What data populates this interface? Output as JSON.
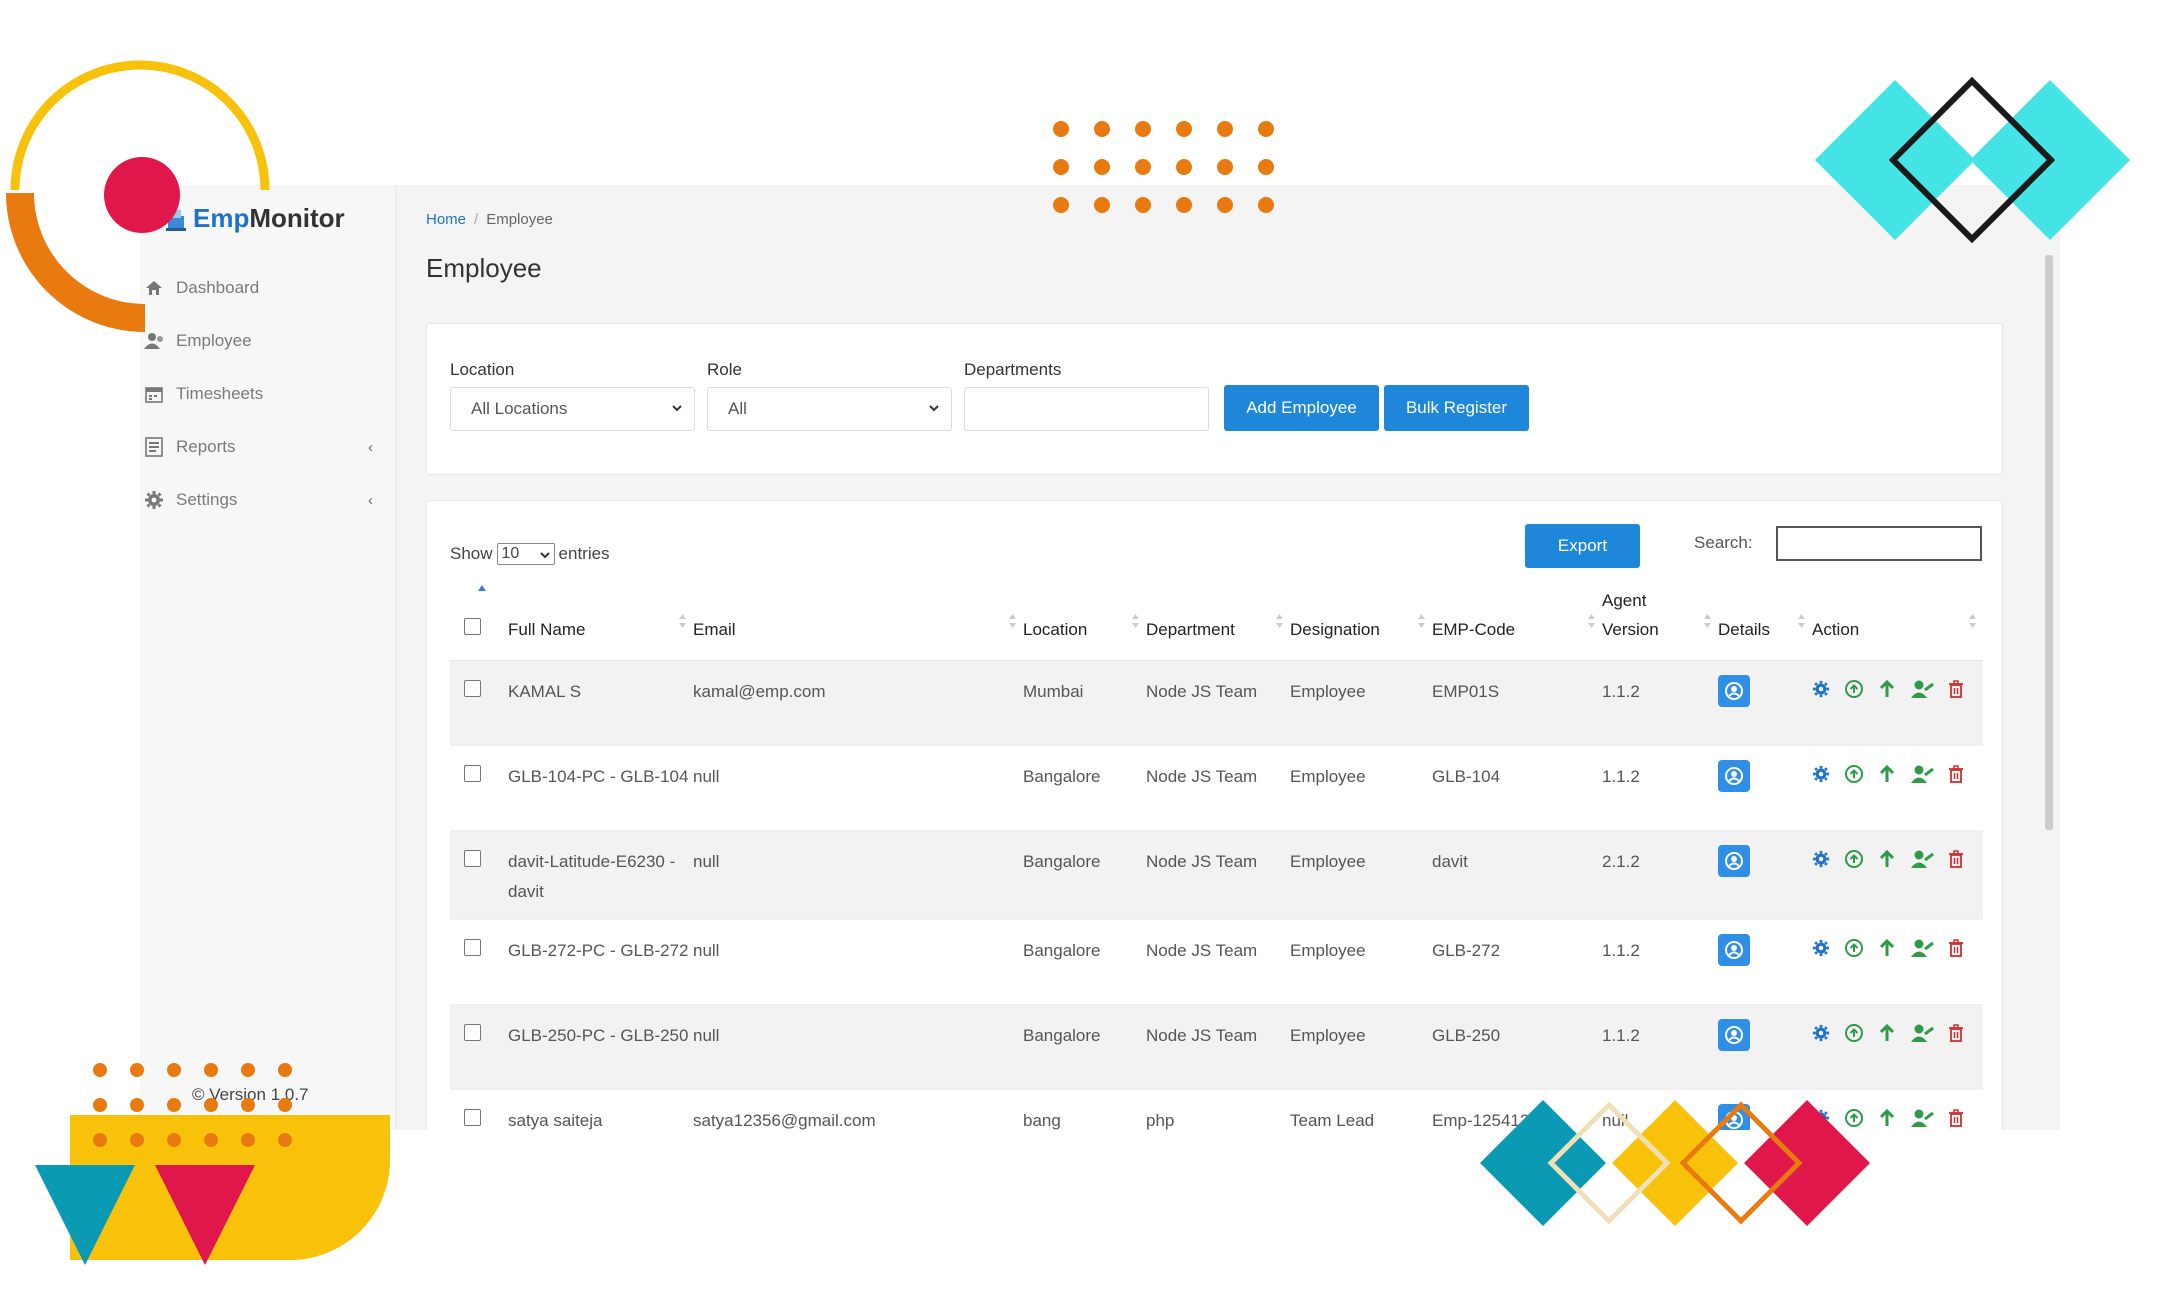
{
  "brand": {
    "part1": "Emp",
    "part2": "Monitor"
  },
  "sidebar": {
    "items": [
      {
        "label": "Dashboard",
        "icon": "home-icon"
      },
      {
        "label": "Employee",
        "icon": "users-icon"
      },
      {
        "label": "Timesheets",
        "icon": "calendar-icon"
      },
      {
        "label": "Reports",
        "icon": "report-icon",
        "chevron": "‹"
      },
      {
        "label": "Settings",
        "icon": "gear-icon",
        "chevron": "‹"
      }
    ],
    "version": "Version 1.0.7"
  },
  "breadcrumb": {
    "home": "Home",
    "separator": "/",
    "current": "Employee"
  },
  "page_title": "Employee",
  "filters": {
    "location_label": "Location",
    "location_value": "All Locations",
    "role_label": "Role",
    "role_value": "All",
    "departments_label": "Departments",
    "departments_value": "",
    "add_employee": "Add Employee",
    "bulk_register": "Bulk Register"
  },
  "table_controls": {
    "show": "Show",
    "entries_value": "10",
    "entries": "entries",
    "export": "Export",
    "search_label": "Search:"
  },
  "columns": {
    "full_name": "Full Name",
    "email": "Email",
    "location": "Location",
    "department": "Department",
    "designation": "Designation",
    "emp_code": "EMP-Code",
    "agent_version": "Agent Version",
    "details": "Details",
    "action": "Action"
  },
  "rows": [
    {
      "name": "KAMAL S",
      "email": "kamal@emp.com",
      "location": "Mumbai",
      "department": "Node JS Team",
      "designation": "Employee",
      "code": "EMP01S",
      "version": "1.1.2"
    },
    {
      "name": "GLB-104-PC - GLB-104",
      "email": "null",
      "location": "Bangalore",
      "department": "Node JS Team",
      "designation": "Employee",
      "code": "GLB-104",
      "version": "1.1.2"
    },
    {
      "name": "davit-Latitude-E6230 - davit",
      "email": "null",
      "location": "Bangalore",
      "department": "Node JS Team",
      "designation": "Employee",
      "code": "davit",
      "version": "2.1.2"
    },
    {
      "name": "GLB-272-PC - GLB-272",
      "email": "null",
      "location": "Bangalore",
      "department": "Node JS Team",
      "designation": "Employee",
      "code": "GLB-272",
      "version": "1.1.2"
    },
    {
      "name": "GLB-250-PC - GLB-250",
      "email": "null",
      "location": "Bangalore",
      "department": "Node JS Team",
      "designation": "Employee",
      "code": "GLB-250",
      "version": "1.1.2"
    },
    {
      "name": "satya saiteja",
      "email": "satya12356@gmail.com",
      "location": "bang",
      "department": "php",
      "designation": "Team Lead",
      "code": "Emp-12541236",
      "version": "null"
    }
  ],
  "colors": {
    "accent": "#1e87d9",
    "deco_orange": "#e87a10",
    "deco_yellow": "#f8c20a",
    "deco_red": "#e0174a",
    "deco_cyan": "#43e3e6",
    "deco_teal": "#0a9ab3"
  }
}
